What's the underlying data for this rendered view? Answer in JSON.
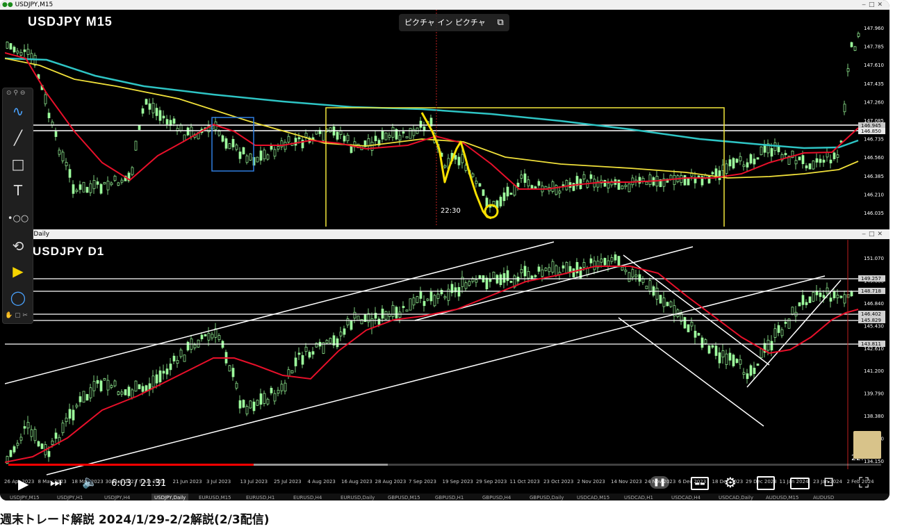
{
  "top_window": {
    "title": "USDJPY,M15",
    "symbol_label": "USDJPY M15",
    "price_axis": [
      "147.960",
      "147.785",
      "147.610",
      "147.435",
      "147.260",
      "147.085",
      "146.735",
      "146.560",
      "146.385",
      "146.210",
      "146.035"
    ],
    "price_tags": [
      "146.945",
      "146.850"
    ],
    "crosshair_time": "22:30"
  },
  "bottom_window": {
    "title": "Y,Daily",
    "symbol_label": "USDJPY D1",
    "price_axis": [
      "151.070",
      "149.660",
      "146.840",
      "145.430",
      "142.610",
      "141.200",
      "139.790",
      "138.380",
      "136.970",
      "134.150"
    ],
    "price_tags": [
      "149.257",
      "148.718",
      "146.402",
      "145.829",
      "143.811"
    ],
    "crosshair_label": "22:",
    "date_axis": [
      "26 Apr 2023",
      "8 May 2023",
      "18 May 2023",
      "30 May 2023",
      "9 Jun 2023",
      "21 Jun 2023",
      "3 Jul 2023",
      "13 Jul 2023",
      "25 Jul 2023",
      "4 Aug 2023",
      "16 Aug 2023",
      "28 Aug 2023",
      "7 Sep 2023",
      "19 Sep 2023",
      "29 Sep 2023",
      "11 Oct 2023",
      "23 Oct 2023",
      "2 Nov 2023",
      "14 Nov 2023",
      "24 Nov 2023",
      "6 Dec 2023",
      "18 Dec 2023",
      "29 Dec 2023",
      "11 Jan 2024",
      "23 Jan 2024",
      "2 Feb 2024"
    ]
  },
  "symbol_tabs": [
    "USDJPY,M15",
    "USDJPY,H1",
    "USDJPY,H4",
    "USDJPY,Daily",
    "EURUSD,M15",
    "EURUSD,H1",
    "EURUSD,H4",
    "EURUSD,Daily",
    "GBPUSD,M15",
    "GBPUSD,H1",
    "GBPUSD,H4",
    "GBPUSD,Daily",
    "USDCAD,M15",
    "USDCAD,H1",
    "USDCAD,H4",
    "USDCAD,Daily",
    "AUDUSD,M15",
    "AUDUSD"
  ],
  "pip_label": "ピクチャ イン ピクチャ",
  "player": {
    "time_display": "6:03 / 21:31",
    "progress": 0.281,
    "buffered": 0.435
  },
  "video_title": "週末トレード解説 2024/1/29-2/2解説(2/3配信)",
  "colors": {
    "bull": "#9dff9d",
    "ma_red": "#e8102a",
    "ma_yellow": "#f0e03a",
    "ma_cyan": "#2ec4c4",
    "progress_red": "#ff0000",
    "box_yellow": "#f2e83c",
    "box_blue": "#2f7de0"
  },
  "icons": {
    "play": "play-icon",
    "next": "next-icon",
    "volume": "volume-icon",
    "pause": "pause-icon",
    "subtitles": "subtitles-icon",
    "settings": "gear-icon",
    "miniplayer": "miniplayer-icon",
    "theater": "theater-icon",
    "cast": "cast-icon",
    "fullscreen": "fullscreen-icon"
  }
}
